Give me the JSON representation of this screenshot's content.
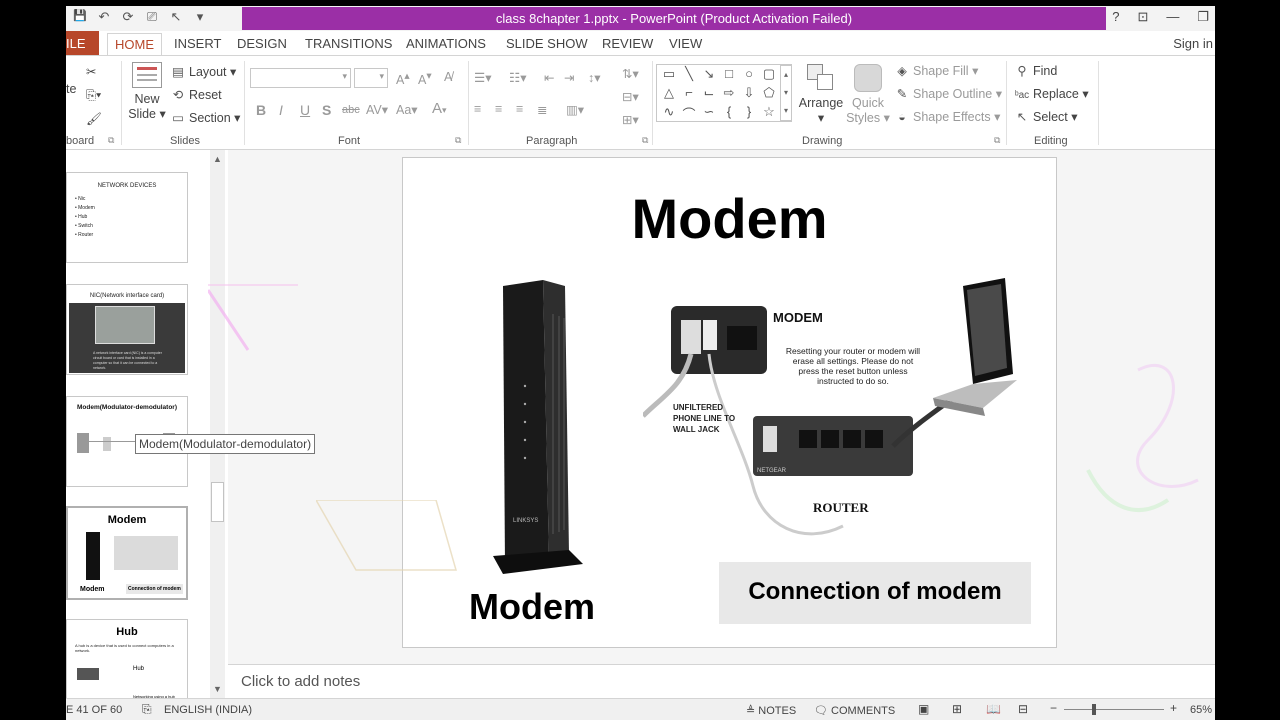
{
  "window": {
    "title": "class 8chapter 1.pptx - PowerPoint (Product Activation Failed)",
    "controls": [
      "?",
      "⊡",
      "—",
      "❐"
    ]
  },
  "qat": {
    "save": "💾",
    "undo": "↶",
    "redo": "⟳",
    "present": "⎚",
    "pointer": "↖",
    "more": "▾"
  },
  "tabs": {
    "file": "ILE",
    "home": "HOME",
    "insert": "INSERT",
    "design": "DESIGN",
    "transitions": "TRANSITIONS",
    "animations": "ANIMATIONS",
    "slideshow": "SLIDE SHOW",
    "review": "REVIEW",
    "view": "VIEW",
    "signin": "Sign in"
  },
  "ribbon": {
    "clipboard_label": "board",
    "paste_label": "te",
    "slides_label": "Slides",
    "new_slide_line1": "New",
    "new_slide_line2": "Slide",
    "layout": "Layout",
    "reset": "Reset",
    "section": "Section",
    "font_label": "Font",
    "paragraph_label": "Paragraph",
    "drawing_label": "Drawing",
    "arrange": "Arrange",
    "quick_line1": "Quick",
    "quick_line2": "Styles",
    "shape_fill": "Shape Fill",
    "shape_outline": "Shape Outline",
    "shape_effects": "Shape Effects",
    "editing_label": "Editing",
    "find": "Find",
    "replace": "Replace",
    "select": "Select",
    "font_buttons": [
      "B",
      "I",
      "U",
      "S",
      "abc",
      "AV",
      "Aa",
      "A"
    ]
  },
  "thumbnails": [
    {
      "title": "NETWORK DEVICES",
      "bullets": [
        "Nic",
        "Modem",
        "Hub",
        "Switch",
        "Router"
      ]
    },
    {
      "title": "NIC(Network interface card)",
      "body": "A network interface card (NIC) is a computer circuit board or card that is installed in a computer so that it can be connected to a network."
    },
    {
      "title": "Modem(Modulator-demodulator)"
    },
    {
      "title": "Modem",
      "caption_left": "Modem",
      "caption_right": "Connection of modem"
    },
    {
      "title": "Hub",
      "body": "A hub is a device that is used to connect computers in a network.",
      "label_a": "Hub",
      "label_b": "Networking using a hub"
    }
  ],
  "tooltip": "Modem(Modulator-demodulator)",
  "slide": {
    "title": "Modem",
    "caption": "Modem",
    "connection": "Connection of modem",
    "diagram": {
      "modem_label": "MODEM",
      "note": "Resetting your router or modem will erase all settings. Please do not press the reset button unless instructed to do so.",
      "phone_line": "UNFILTERED PHONE LINE TO WALL JACK",
      "router_label": "ROUTER",
      "brand": "LINKSYS",
      "netgear": "NETGEAR"
    }
  },
  "notes": {
    "placeholder": "Click to add notes"
  },
  "status": {
    "slide_counter": "E 41 OF 60",
    "language": "ENGLISH (INDIA)",
    "notes": "NOTES",
    "comments": "COMMENTS",
    "zoom": "65%"
  },
  "colors": {
    "accent": "#b7472a",
    "activation": "#9b2fa6"
  }
}
